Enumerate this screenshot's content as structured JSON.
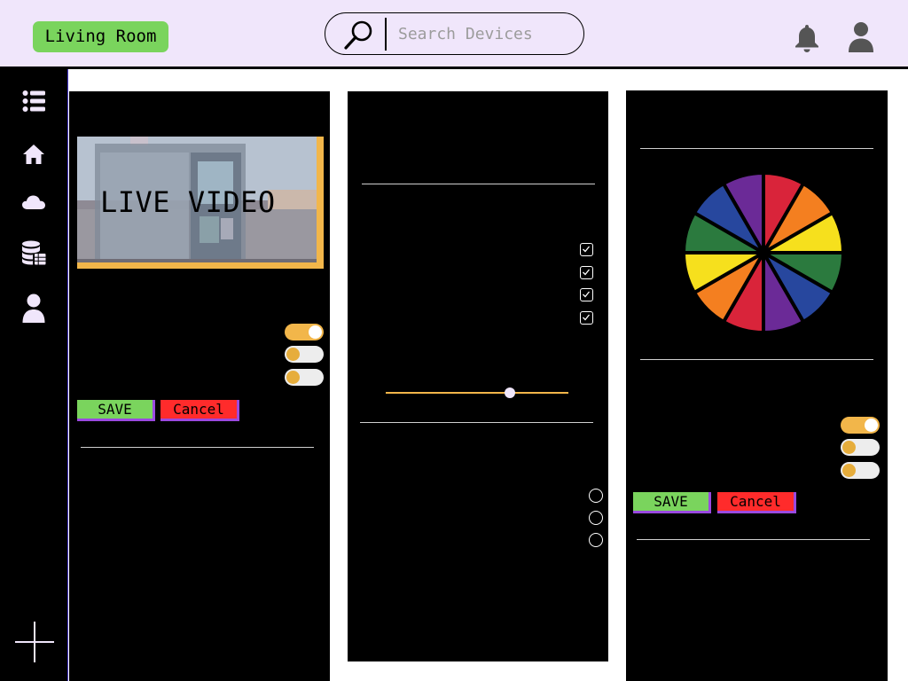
{
  "header": {
    "room": "Living Room",
    "search": {
      "placeholder": "Search Devices",
      "value": ""
    },
    "icons": [
      "search-icon",
      "bell-icon",
      "user-icon"
    ]
  },
  "sidebar": {
    "items": [
      {
        "icon": "list-icon"
      },
      {
        "icon": "home-icon"
      },
      {
        "icon": "cloud-icon"
      },
      {
        "icon": "database-icon"
      },
      {
        "icon": "user-icon"
      }
    ],
    "add_icon": "plus-icon"
  },
  "panel1": {
    "video_label": "LIVE VIDEO",
    "toggles": [
      true,
      false,
      false
    ],
    "save_label": "SAVE",
    "cancel_label": "Cancel"
  },
  "panel2": {
    "checkboxes": [
      true,
      true,
      true,
      true
    ],
    "slider_value": 0.68,
    "radios": [
      false,
      false,
      false
    ]
  },
  "panel3": {
    "color_wheel": [
      "#d9243a",
      "#f47f20",
      "#f6e01d",
      "#2b7a3e",
      "#27479e",
      "#6b2a97",
      "#d9243a",
      "#f47f20",
      "#f6e01d",
      "#2b7a3e",
      "#27479e",
      "#6b2a97"
    ],
    "toggles": [
      true,
      false,
      false
    ],
    "save_label": "SAVE",
    "cancel_label": "Cancel"
  },
  "colors": {
    "accent": "#f2b64a",
    "save": "#7ad45d",
    "cancel": "#ff2b2b",
    "header_bg": "#f0e6fb",
    "button_shadow": "#9a49e0"
  }
}
